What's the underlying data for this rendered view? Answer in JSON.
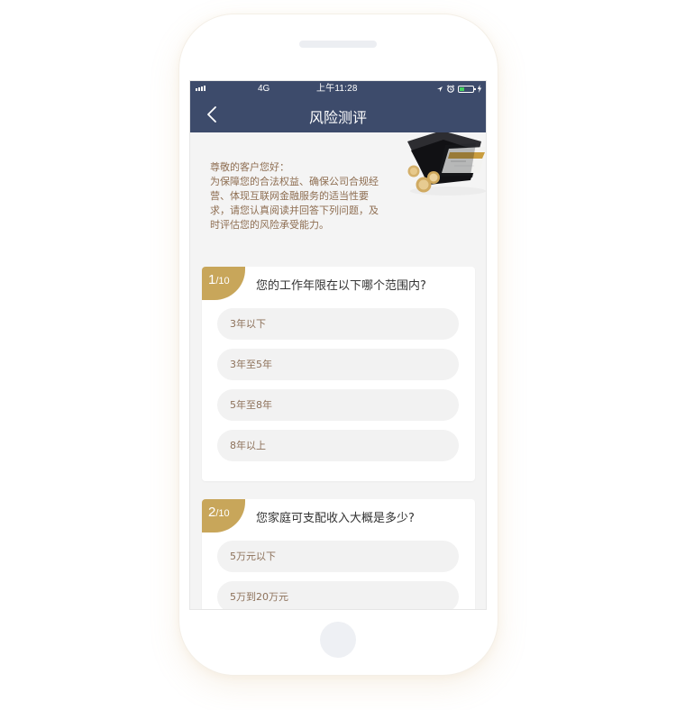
{
  "status_bar": {
    "network": "4G",
    "time": "上午11:28"
  },
  "nav": {
    "title": "风险测评"
  },
  "intro": {
    "greeting": "尊敬的客户您好：",
    "text": "为保障您的合法权益、确保公司合规经营、体现互联网金融服务的适当性要求，请您认真阅读并回答下列问题，及时评估您的风险承受能力。"
  },
  "questions": [
    {
      "number": "1",
      "total": "/10",
      "text": "您的工作年限在以下哪个范围内?",
      "options": [
        "3年以下",
        "3年至5年",
        "5年至8年",
        "8年以上"
      ]
    },
    {
      "number": "2",
      "total": "/10",
      "text": "您家庭可支配收入大概是多少?",
      "options": [
        "5万元以下",
        "5万到20万元"
      ]
    }
  ],
  "icons": {
    "back": "chevron-left-icon",
    "location": "location-arrow-icon",
    "alarm": "alarm-icon",
    "battery": "battery-icon",
    "charging": "charging-bolt-icon"
  },
  "colors": {
    "header": "#3d4b6b",
    "accent_gold": "#c8a65a",
    "intro_text": "#8e6e52",
    "option_bg": "#f2f2f2",
    "option_text": "#8d715a"
  }
}
